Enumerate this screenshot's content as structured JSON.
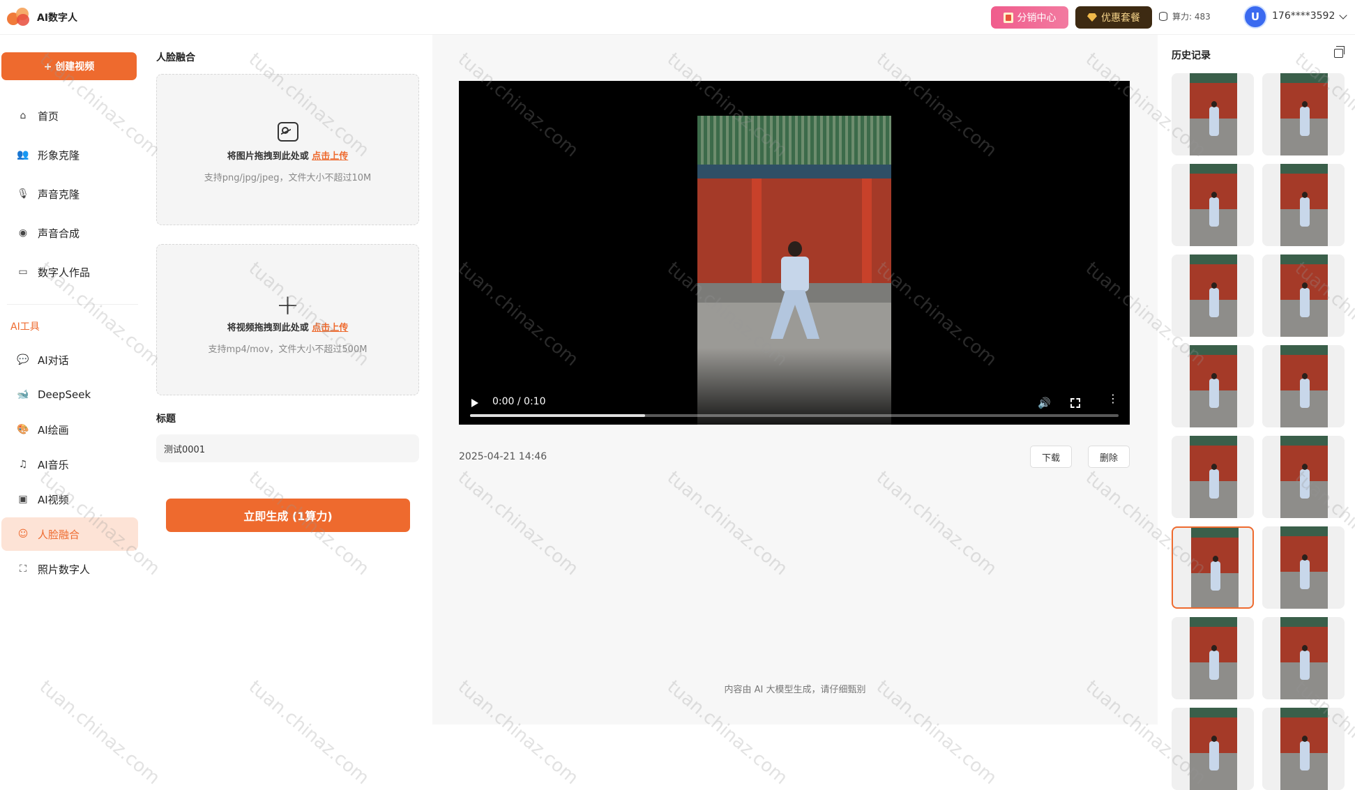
{
  "header": {
    "brand": "AI数字人",
    "distribution_label": "分销中心",
    "package_label": "优惠套餐",
    "power_label": "算力: 483",
    "avatar_glyph": "U",
    "phone": "176****3592"
  },
  "sidebar": {
    "create_label": "+ 创建视频",
    "main_items": [
      {
        "label": "首页",
        "icon": "home-icon"
      },
      {
        "label": "形象克隆",
        "icon": "user-clone-icon"
      },
      {
        "label": "声音克隆",
        "icon": "microphone-icon"
      },
      {
        "label": "声音合成",
        "icon": "waveform-icon"
      },
      {
        "label": "数字人作品",
        "icon": "video-camera-icon"
      }
    ],
    "section_label": "AI工具",
    "tool_items": [
      {
        "label": "AI对话",
        "icon": "chat-icon"
      },
      {
        "label": "DeepSeek",
        "icon": "deepseek-icon"
      },
      {
        "label": "AI绘画",
        "icon": "palette-icon"
      },
      {
        "label": "AI音乐",
        "icon": "music-note-icon"
      },
      {
        "label": "AI视频",
        "icon": "video-icon"
      },
      {
        "label": "人脸融合",
        "icon": "face-icon",
        "active": true
      },
      {
        "label": "照片数字人",
        "icon": "face-scan-icon"
      }
    ]
  },
  "form": {
    "title": "人脸融合",
    "image_drop": {
      "text": "将图片拖拽到此处或",
      "link": "点击上传",
      "hint": "支持png/jpg/jpeg，文件大小不超过10M"
    },
    "video_drop": {
      "text": "将视频拖拽到此处或",
      "link": "点击上传",
      "hint": "支持mp4/mov，文件大小不超过500M"
    },
    "title_label": "标题",
    "title_value": "测试0001",
    "generate_label": "立即生成 (1算力)"
  },
  "player": {
    "time": "0:00 / 0:10",
    "progress": 0.27
  },
  "result": {
    "date": "2025-04-21 14:46",
    "download_label": "下载",
    "delete_label": "删除",
    "footer": "内容由 AI 大模型生成，请仔细甄别"
  },
  "history": {
    "title": "历史记录",
    "thumbnails": 16,
    "selected_index": 10
  },
  "watermark": "tuan.chinaz.com",
  "colors": {
    "accent": "#ee6a2e",
    "pink": "#f05c8c",
    "gold_bg": "#3d2a12"
  }
}
